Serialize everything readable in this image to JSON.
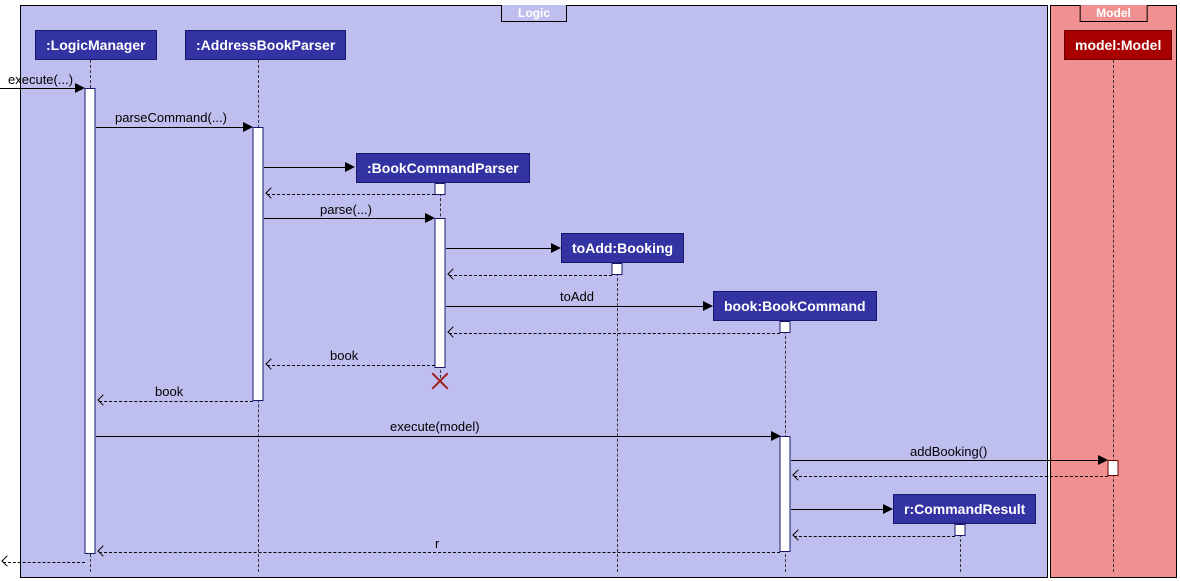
{
  "frames": {
    "logic": {
      "title": "Logic"
    },
    "model": {
      "title": "Model"
    }
  },
  "participants": {
    "logicManager": ":LogicManager",
    "addressBookParser": ":AddressBookParser",
    "bookCommandParser": ":BookCommandParser",
    "booking": "toAdd:Booking",
    "bookCommand": "book:BookCommand",
    "commandResult": "r:CommandResult",
    "model": "model:Model"
  },
  "messages": {
    "execute_in": "execute(...)",
    "parseCommand": "parseCommand(...)",
    "parse": "parse(...)",
    "toAdd": "toAdd",
    "book_return1": "book",
    "book_return2": "book",
    "executeModel": "execute(model)",
    "addBooking": "addBooking()",
    "r_return": "r"
  }
}
